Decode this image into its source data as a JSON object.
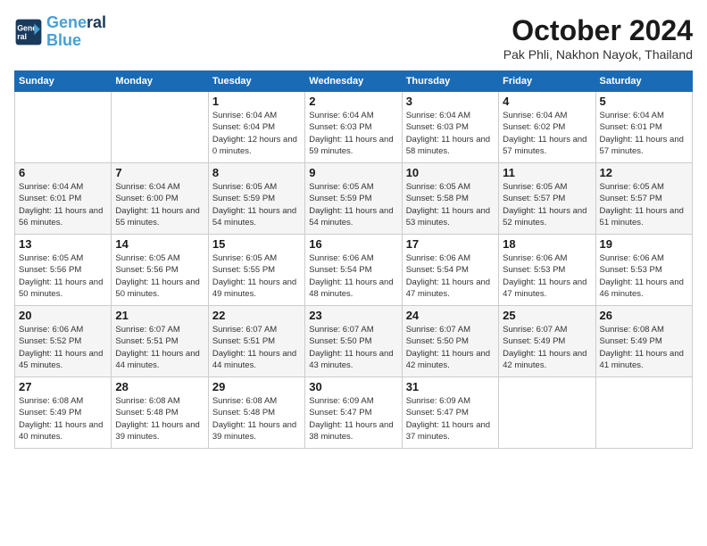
{
  "header": {
    "logo_line1": "General",
    "logo_line2": "Blue",
    "month": "October 2024",
    "location": "Pak Phli, Nakhon Nayok, Thailand"
  },
  "weekdays": [
    "Sunday",
    "Monday",
    "Tuesday",
    "Wednesday",
    "Thursday",
    "Friday",
    "Saturday"
  ],
  "weeks": [
    [
      {
        "day": "",
        "sunrise": "",
        "sunset": "",
        "daylight": ""
      },
      {
        "day": "",
        "sunrise": "",
        "sunset": "",
        "daylight": ""
      },
      {
        "day": "1",
        "sunrise": "Sunrise: 6:04 AM",
        "sunset": "Sunset: 6:04 PM",
        "daylight": "Daylight: 12 hours and 0 minutes."
      },
      {
        "day": "2",
        "sunrise": "Sunrise: 6:04 AM",
        "sunset": "Sunset: 6:03 PM",
        "daylight": "Daylight: 11 hours and 59 minutes."
      },
      {
        "day": "3",
        "sunrise": "Sunrise: 6:04 AM",
        "sunset": "Sunset: 6:03 PM",
        "daylight": "Daylight: 11 hours and 58 minutes."
      },
      {
        "day": "4",
        "sunrise": "Sunrise: 6:04 AM",
        "sunset": "Sunset: 6:02 PM",
        "daylight": "Daylight: 11 hours and 57 minutes."
      },
      {
        "day": "5",
        "sunrise": "Sunrise: 6:04 AM",
        "sunset": "Sunset: 6:01 PM",
        "daylight": "Daylight: 11 hours and 57 minutes."
      }
    ],
    [
      {
        "day": "6",
        "sunrise": "Sunrise: 6:04 AM",
        "sunset": "Sunset: 6:01 PM",
        "daylight": "Daylight: 11 hours and 56 minutes."
      },
      {
        "day": "7",
        "sunrise": "Sunrise: 6:04 AM",
        "sunset": "Sunset: 6:00 PM",
        "daylight": "Daylight: 11 hours and 55 minutes."
      },
      {
        "day": "8",
        "sunrise": "Sunrise: 6:05 AM",
        "sunset": "Sunset: 5:59 PM",
        "daylight": "Daylight: 11 hours and 54 minutes."
      },
      {
        "day": "9",
        "sunrise": "Sunrise: 6:05 AM",
        "sunset": "Sunset: 5:59 PM",
        "daylight": "Daylight: 11 hours and 54 minutes."
      },
      {
        "day": "10",
        "sunrise": "Sunrise: 6:05 AM",
        "sunset": "Sunset: 5:58 PM",
        "daylight": "Daylight: 11 hours and 53 minutes."
      },
      {
        "day": "11",
        "sunrise": "Sunrise: 6:05 AM",
        "sunset": "Sunset: 5:57 PM",
        "daylight": "Daylight: 11 hours and 52 minutes."
      },
      {
        "day": "12",
        "sunrise": "Sunrise: 6:05 AM",
        "sunset": "Sunset: 5:57 PM",
        "daylight": "Daylight: 11 hours and 51 minutes."
      }
    ],
    [
      {
        "day": "13",
        "sunrise": "Sunrise: 6:05 AM",
        "sunset": "Sunset: 5:56 PM",
        "daylight": "Daylight: 11 hours and 50 minutes."
      },
      {
        "day": "14",
        "sunrise": "Sunrise: 6:05 AM",
        "sunset": "Sunset: 5:56 PM",
        "daylight": "Daylight: 11 hours and 50 minutes."
      },
      {
        "day": "15",
        "sunrise": "Sunrise: 6:05 AM",
        "sunset": "Sunset: 5:55 PM",
        "daylight": "Daylight: 11 hours and 49 minutes."
      },
      {
        "day": "16",
        "sunrise": "Sunrise: 6:06 AM",
        "sunset": "Sunset: 5:54 PM",
        "daylight": "Daylight: 11 hours and 48 minutes."
      },
      {
        "day": "17",
        "sunrise": "Sunrise: 6:06 AM",
        "sunset": "Sunset: 5:54 PM",
        "daylight": "Daylight: 11 hours and 47 minutes."
      },
      {
        "day": "18",
        "sunrise": "Sunrise: 6:06 AM",
        "sunset": "Sunset: 5:53 PM",
        "daylight": "Daylight: 11 hours and 47 minutes."
      },
      {
        "day": "19",
        "sunrise": "Sunrise: 6:06 AM",
        "sunset": "Sunset: 5:53 PM",
        "daylight": "Daylight: 11 hours and 46 minutes."
      }
    ],
    [
      {
        "day": "20",
        "sunrise": "Sunrise: 6:06 AM",
        "sunset": "Sunset: 5:52 PM",
        "daylight": "Daylight: 11 hours and 45 minutes."
      },
      {
        "day": "21",
        "sunrise": "Sunrise: 6:07 AM",
        "sunset": "Sunset: 5:51 PM",
        "daylight": "Daylight: 11 hours and 44 minutes."
      },
      {
        "day": "22",
        "sunrise": "Sunrise: 6:07 AM",
        "sunset": "Sunset: 5:51 PM",
        "daylight": "Daylight: 11 hours and 44 minutes."
      },
      {
        "day": "23",
        "sunrise": "Sunrise: 6:07 AM",
        "sunset": "Sunset: 5:50 PM",
        "daylight": "Daylight: 11 hours and 43 minutes."
      },
      {
        "day": "24",
        "sunrise": "Sunrise: 6:07 AM",
        "sunset": "Sunset: 5:50 PM",
        "daylight": "Daylight: 11 hours and 42 minutes."
      },
      {
        "day": "25",
        "sunrise": "Sunrise: 6:07 AM",
        "sunset": "Sunset: 5:49 PM",
        "daylight": "Daylight: 11 hours and 42 minutes."
      },
      {
        "day": "26",
        "sunrise": "Sunrise: 6:08 AM",
        "sunset": "Sunset: 5:49 PM",
        "daylight": "Daylight: 11 hours and 41 minutes."
      }
    ],
    [
      {
        "day": "27",
        "sunrise": "Sunrise: 6:08 AM",
        "sunset": "Sunset: 5:49 PM",
        "daylight": "Daylight: 11 hours and 40 minutes."
      },
      {
        "day": "28",
        "sunrise": "Sunrise: 6:08 AM",
        "sunset": "Sunset: 5:48 PM",
        "daylight": "Daylight: 11 hours and 39 minutes."
      },
      {
        "day": "29",
        "sunrise": "Sunrise: 6:08 AM",
        "sunset": "Sunset: 5:48 PM",
        "daylight": "Daylight: 11 hours and 39 minutes."
      },
      {
        "day": "30",
        "sunrise": "Sunrise: 6:09 AM",
        "sunset": "Sunset: 5:47 PM",
        "daylight": "Daylight: 11 hours and 38 minutes."
      },
      {
        "day": "31",
        "sunrise": "Sunrise: 6:09 AM",
        "sunset": "Sunset: 5:47 PM",
        "daylight": "Daylight: 11 hours and 37 minutes."
      },
      {
        "day": "",
        "sunrise": "",
        "sunset": "",
        "daylight": ""
      },
      {
        "day": "",
        "sunrise": "",
        "sunset": "",
        "daylight": ""
      }
    ]
  ]
}
